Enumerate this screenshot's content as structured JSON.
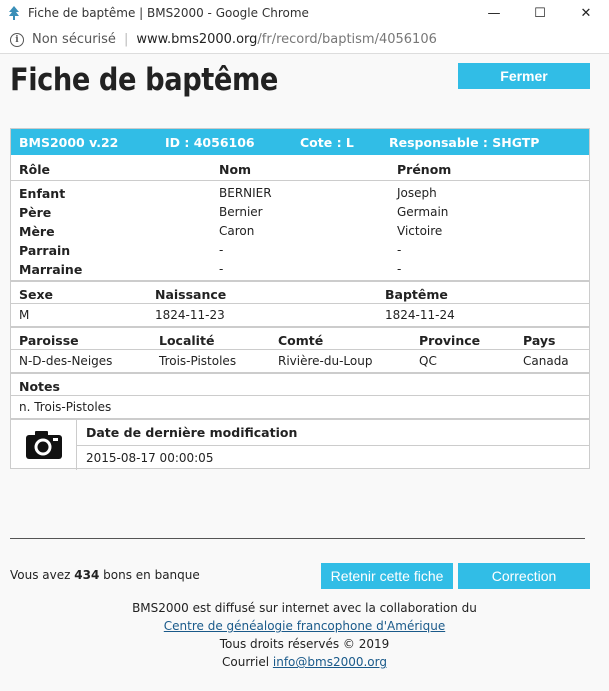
{
  "window": {
    "title": "Fiche de baptême | BMS2000 - Google Chrome",
    "minimize": "—",
    "maximize": "☐",
    "close": "✕"
  },
  "address": {
    "security": "Non sécurisé",
    "host": "www.bms2000.org",
    "path": "/fr/record/baptism/4056106"
  },
  "page": {
    "title": "Fiche de baptême",
    "close_button": "Fermer"
  },
  "record_header": {
    "version": "BMS2000 v.22",
    "id": "ID : 4056106",
    "cote": "Cote : L",
    "responsable": "Responsable : SHGTP"
  },
  "people": {
    "headers": [
      "Rôle",
      "Nom",
      "Prénom"
    ],
    "rows": [
      [
        "Enfant",
        "BERNIER",
        "Joseph"
      ],
      [
        "Père",
        "Bernier",
        "Germain"
      ],
      [
        "Mère",
        "Caron",
        "Victoire"
      ],
      [
        "Parrain",
        "-",
        "-"
      ],
      [
        "Marraine",
        "-",
        "-"
      ]
    ]
  },
  "dates": {
    "headers": [
      "Sexe",
      "Naissance",
      "Baptême"
    ],
    "values": [
      "M",
      "1824-11-23",
      "1824-11-24"
    ]
  },
  "place": {
    "headers": [
      "Paroisse",
      "Localité",
      "Comté",
      "Province",
      "Pays"
    ],
    "values": [
      "N-D-des-Neiges",
      "Trois-Pistoles",
      "Rivière-du-Loup",
      "QC",
      "Canada"
    ]
  },
  "notes": {
    "header": "Notes",
    "value": "n. Trois-Pistoles"
  },
  "last_modified": {
    "header": "Date de dernière modification",
    "value": "2015-08-17 00:00:05"
  },
  "bank": {
    "prefix": "Vous avez",
    "count": "434",
    "suffix": "bons en banque"
  },
  "actions": {
    "keep": "Retenir cette fiche",
    "correction": "Correction"
  },
  "footer": {
    "line1": "BMS2000 est diffusé sur internet avec la collaboration du",
    "link": "Centre de généalogie francophone d'Amérique",
    "rights": "Tous droits réservés © 2019",
    "email_label": "Courriel",
    "email": "info@bms2000.org"
  },
  "colors": {
    "accent": "#31bde6"
  }
}
